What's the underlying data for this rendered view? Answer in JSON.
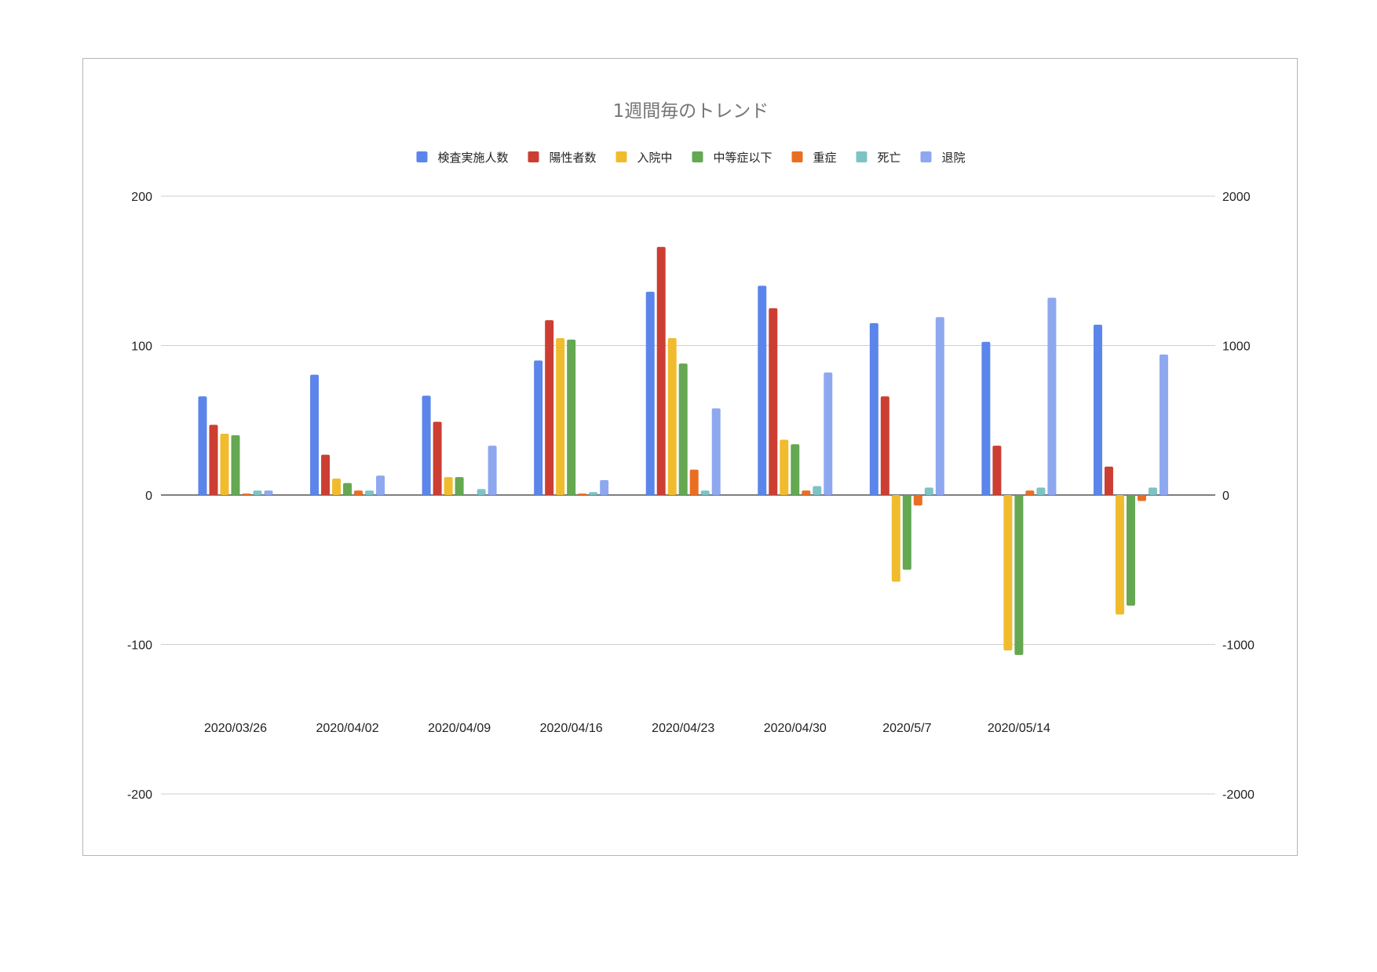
{
  "chart_data": {
    "type": "bar",
    "title": "1週間毎のトレンド",
    "legend_position": "top",
    "grid": true,
    "categories": [
      "2020/03/26",
      "2020/04/02",
      "2020/04/09",
      "2020/04/16",
      "2020/04/23",
      "2020/04/30",
      "2020/5/7",
      "2020/05/14",
      ""
    ],
    "y_left": {
      "range": [
        -200,
        200
      ],
      "ticks": [
        "200",
        "100",
        "0",
        "-100",
        "-200"
      ]
    },
    "y_right": {
      "range": [
        -2000,
        2000
      ],
      "ticks": [
        "2000",
        "1000",
        "0",
        "-1000",
        "-2000"
      ]
    },
    "series": [
      {
        "name": "検査実施人数",
        "color": "#5b85ea",
        "axis": "right",
        "values": [
          660,
          805,
          665,
          900,
          1360,
          1400,
          1150,
          1025,
          1140
        ]
      },
      {
        "name": "陽性者数",
        "color": "#cc3e33",
        "axis": "left",
        "values": [
          47,
          27,
          49,
          117,
          166,
          125,
          66,
          33,
          19
        ]
      },
      {
        "name": "入院中",
        "color": "#f0bc2e",
        "axis": "left",
        "values": [
          41,
          11,
          12,
          105,
          105,
          37,
          -58,
          -104,
          -80
        ]
      },
      {
        "name": "中等症以下",
        "color": "#64a852",
        "axis": "left",
        "values": [
          40,
          8,
          12,
          104,
          88,
          34,
          -50,
          -107,
          -74
        ]
      },
      {
        "name": "重症",
        "color": "#ea6e22",
        "axis": "left",
        "values": [
          1,
          3,
          0,
          1,
          17,
          3,
          -7,
          3,
          -4
        ]
      },
      {
        "name": "死亡",
        "color": "#7ec3c4",
        "axis": "left",
        "values": [
          3,
          3,
          4,
          2,
          3,
          6,
          5,
          5,
          5
        ]
      },
      {
        "name": "退院",
        "color": "#8ea8f0",
        "axis": "left",
        "values": [
          3,
          13,
          33,
          10,
          58,
          82,
          119,
          132,
          94
        ]
      }
    ]
  }
}
